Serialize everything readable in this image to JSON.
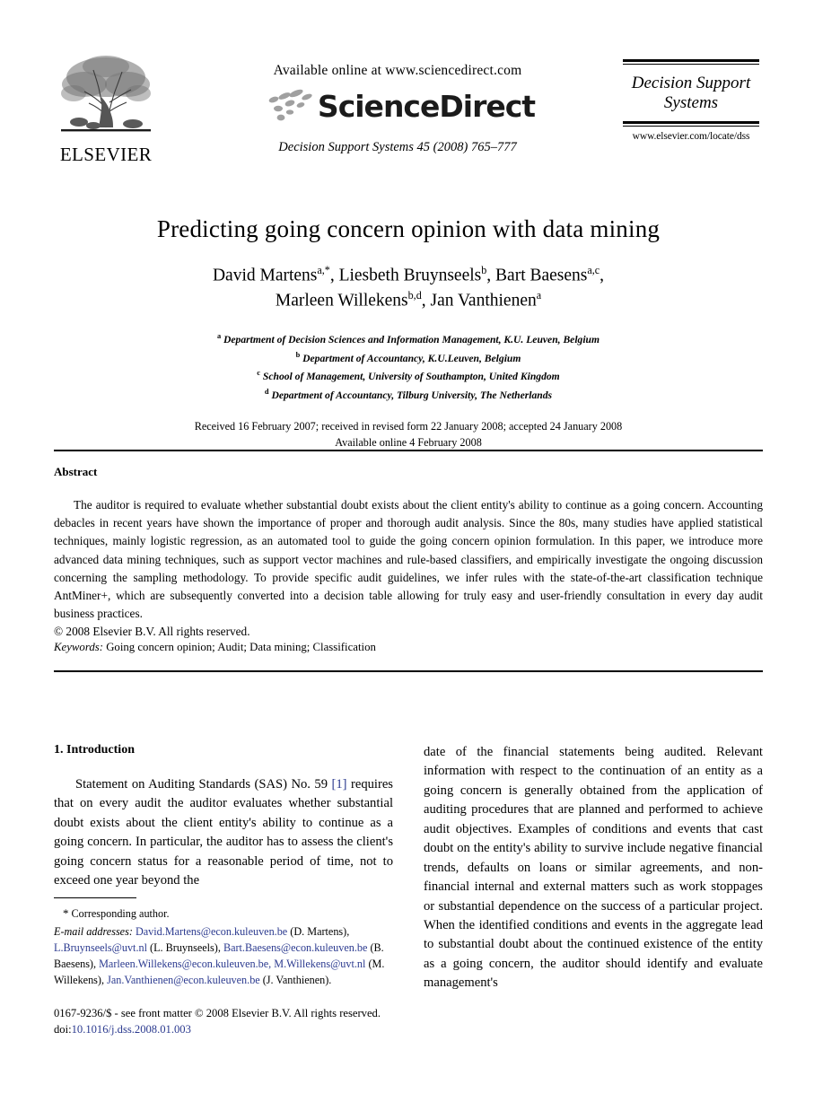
{
  "masthead": {
    "publisher_logo_name": "ELSEVIER",
    "available_online": "Available online at www.sciencedirect.com",
    "sciencedirect_wordmark": "ScienceDirect",
    "journal_citation_line": "Decision Support Systems 45 (2008) 765–777",
    "journal_box": {
      "title_line1": "Decision Support",
      "title_line2": "Systems",
      "url": "www.elsevier.com/locate/dss"
    }
  },
  "article": {
    "title": "Predicting going concern opinion with data mining",
    "authors_line1": "David Martens",
    "authors_line1_sup1": "a,*",
    "authors_line1_b": ", Liesbeth Bruynseels",
    "authors_line1_sup2": "b",
    "authors_line1_c": ", Bart Baesens",
    "authors_line1_sup3": "a,c",
    "authors_line1_tail": ",",
    "authors_line2": "Marleen Willekens",
    "authors_line2_sup1": "b,d",
    "authors_line2_b": ", Jan Vanthienen",
    "authors_line2_sup2": "a",
    "affiliations": [
      {
        "marker": "a",
        "text": "Department of Decision Sciences and Information Management, K.U. Leuven, Belgium"
      },
      {
        "marker": "b",
        "text": "Department of Accountancy, K.U.Leuven, Belgium"
      },
      {
        "marker": "c",
        "text": "School of Management, University of Southampton, United Kingdom"
      },
      {
        "marker": "d",
        "text": "Department of Accountancy, Tilburg University, The Netherlands"
      }
    ],
    "history_line1": "Received 16 February 2007; received in revised form 22 January 2008; accepted 24 January 2008",
    "history_line2": "Available online 4 February 2008"
  },
  "abstract": {
    "heading": "Abstract",
    "body": "The auditor is required to evaluate whether substantial doubt exists about the client entity's ability to continue as a going concern. Accounting debacles in recent years have shown the importance of proper and thorough audit analysis. Since the 80s, many studies have applied statistical techniques, mainly logistic regression, as an automated tool to guide the going concern opinion formulation. In this paper, we introduce more advanced data mining techniques, such as support vector machines and rule-based classifiers, and empirically investigate the ongoing discussion concerning the sampling methodology. To provide specific audit guidelines, we infer rules with the state-of-the-art classification technique AntMiner+, which are subsequently converted into a decision table allowing for truly easy and user-friendly consultation in every day audit business practices.",
    "copyright": "© 2008 Elsevier B.V. All rights reserved."
  },
  "keywords": {
    "label": "Keywords:",
    "value": "Going concern opinion; Audit; Data mining; Classification"
  },
  "body": {
    "section_heading": "1. Introduction",
    "left_col_text_a": "Statement on Auditing Standards (SAS) No. 59 ",
    "left_col_citation": "[1]",
    "left_col_text_b": " requires that on every audit the auditor evaluates whether substantial doubt exists about the client entity's ability to continue as a going concern. In particular, the auditor has to assess the client's going concern status for a reasonable period of time, not to exceed one year beyond the",
    "right_col_text": "date of the financial statements being audited. Relevant information with respect to the continuation of an entity as a going concern is generally obtained from the application of auditing procedures that are planned and performed to achieve audit objectives. Examples of conditions and events that cast doubt on the entity's ability to survive include negative financial trends, defaults on loans or similar agreements, and non-financial internal and external matters such as work stoppages or substantial dependence on the success of a particular project. When the identified conditions and events in the aggregate lead to substantial doubt about the continued existence of the entity as a going concern, the auditor should identify and evaluate management's"
  },
  "footnotes": {
    "corresponding": "Corresponding author.",
    "emails_label": "E-mail addresses:",
    "email_1": "David.Martens@econ.kuleuven.be",
    "email_1_owner": "(D. Martens),",
    "email_2": "L.Bruynseels@uvt.nl",
    "email_2_owner": "(L. Bruynseels),",
    "email_3": "Bart.Baesens@econ.kuleuven.be",
    "email_3_owner": "(B. Baesens),",
    "email_4": "Marleen.Willekens@econ.kuleuven.be,",
    "email_5": "M.Willekens@uvt.nl",
    "email_45_owner": "(M. Willekens),",
    "email_6": "Jan.Vanthienen@econ.kuleuven.be",
    "email_6_owner": "(J. Vanthienen)."
  },
  "imprint": {
    "front_matter": "0167-9236/$ - see front matter © 2008 Elsevier B.V. All rights reserved.",
    "doi_label": "doi:",
    "doi_value": "10.1016/j.dss.2008.01.003"
  },
  "colors": {
    "link": "#2b3a8f",
    "text": "#000000",
    "sd_mark_gray": "#9b9b9b"
  }
}
